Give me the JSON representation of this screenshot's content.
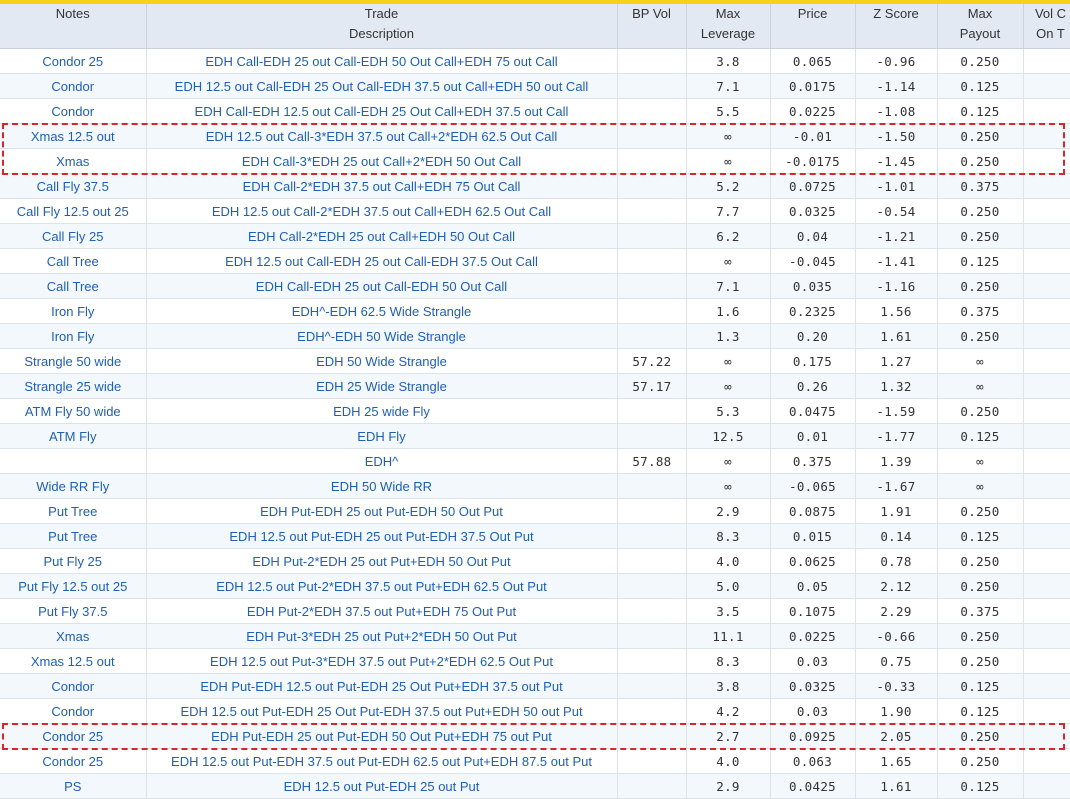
{
  "columns": [
    {
      "line1": "Notes",
      "line2": ""
    },
    {
      "line1": "Trade",
      "line2": "Description"
    },
    {
      "line1": "BP Vol",
      "line2": ""
    },
    {
      "line1": "Max",
      "line2": "Leverage"
    },
    {
      "line1": "Price",
      "line2": ""
    },
    {
      "line1": "Z Score",
      "line2": ""
    },
    {
      "line1": "Max",
      "line2": "Payout"
    },
    {
      "line1": "Vol C",
      "line2": "On T"
    }
  ],
  "rows": [
    {
      "notes": "Condor 25",
      "desc": "EDH Call-EDH 25 out Call-EDH 50 Out Call+EDH 75 out Call",
      "bp": "",
      "lev": "3.8",
      "price": "0.065",
      "z": "-0.96",
      "pay": "0.250",
      "vol": ""
    },
    {
      "notes": "Condor",
      "desc": "EDH 12.5 out Call-EDH 25 Out Call-EDH 37.5 out Call+EDH 50 out Call",
      "bp": "",
      "lev": "7.1",
      "price": "0.0175",
      "z": "-1.14",
      "pay": "0.125",
      "vol": ""
    },
    {
      "notes": "Condor",
      "desc": "EDH Call-EDH 12.5 out Call-EDH 25 Out Call+EDH 37.5 out Call",
      "bp": "",
      "lev": "5.5",
      "price": "0.0225",
      "z": "-1.08",
      "pay": "0.125",
      "vol": ""
    },
    {
      "notes": "Xmas 12.5 out",
      "desc": "EDH 12.5 out Call-3*EDH 37.5 out Call+2*EDH 62.5 Out Call",
      "bp": "",
      "lev": "∞",
      "price": "-0.01",
      "z": "-1.50",
      "pay": "0.250",
      "vol": ""
    },
    {
      "notes": "Xmas",
      "desc": "EDH Call-3*EDH 25 out Call+2*EDH 50 Out Call",
      "bp": "",
      "lev": "∞",
      "price": "-0.0175",
      "z": "-1.45",
      "pay": "0.250",
      "vol": ""
    },
    {
      "notes": "Call Fly 37.5",
      "desc": "EDH Call-2*EDH 37.5 out Call+EDH 75 Out Call",
      "bp": "",
      "lev": "5.2",
      "price": "0.0725",
      "z": "-1.01",
      "pay": "0.375",
      "vol": ""
    },
    {
      "notes": "Call Fly 12.5 out 25",
      "desc": "EDH 12.5 out Call-2*EDH 37.5 out Call+EDH 62.5 Out Call",
      "bp": "",
      "lev": "7.7",
      "price": "0.0325",
      "z": "-0.54",
      "pay": "0.250",
      "vol": ""
    },
    {
      "notes": "Call Fly 25",
      "desc": "EDH Call-2*EDH 25 out Call+EDH 50 Out Call",
      "bp": "",
      "lev": "6.2",
      "price": "0.04",
      "z": "-1.21",
      "pay": "0.250",
      "vol": ""
    },
    {
      "notes": "Call Tree",
      "desc": "EDH 12.5 out Call-EDH 25 out Call-EDH 37.5 Out Call",
      "bp": "",
      "lev": "∞",
      "price": "-0.045",
      "z": "-1.41",
      "pay": "0.125",
      "vol": ""
    },
    {
      "notes": "Call Tree",
      "desc": "EDH Call-EDH 25 out Call-EDH 50 Out Call",
      "bp": "",
      "lev": "7.1",
      "price": "0.035",
      "z": "-1.16",
      "pay": "0.250",
      "vol": ""
    },
    {
      "notes": "Iron Fly",
      "desc": "EDH^-EDH 62.5 Wide Strangle",
      "bp": "",
      "lev": "1.6",
      "price": "0.2325",
      "z": "1.56",
      "pay": "0.375",
      "vol": ""
    },
    {
      "notes": "Iron Fly",
      "desc": "EDH^-EDH 50 Wide Strangle",
      "bp": "",
      "lev": "1.3",
      "price": "0.20",
      "z": "1.61",
      "pay": "0.250",
      "vol": ""
    },
    {
      "notes": "Strangle 50 wide",
      "desc": "EDH 50 Wide Strangle",
      "bp": "57.22",
      "lev": "∞",
      "price": "0.175",
      "z": "1.27",
      "pay": "∞",
      "vol": "("
    },
    {
      "notes": "Strangle 25 wide",
      "desc": "EDH 25 Wide Strangle",
      "bp": "57.17",
      "lev": "∞",
      "price": "0.26",
      "z": "1.32",
      "pay": "∞",
      "vol": "("
    },
    {
      "notes": "ATM Fly 50 wide",
      "desc": "EDH 25 wide Fly",
      "bp": "",
      "lev": "5.3",
      "price": "0.0475",
      "z": "-1.59",
      "pay": "0.250",
      "vol": ""
    },
    {
      "notes": "ATM Fly",
      "desc": "EDH Fly",
      "bp": "",
      "lev": "12.5",
      "price": "0.01",
      "z": "-1.77",
      "pay": "0.125",
      "vol": ""
    },
    {
      "notes": "",
      "desc": "EDH^",
      "bp": "57.88",
      "lev": "∞",
      "price": "0.375",
      "z": "1.39",
      "pay": "∞",
      "vol": "("
    },
    {
      "notes": "Wide RR Fly",
      "desc": "EDH 50 Wide RR",
      "bp": "",
      "lev": "∞",
      "price": "-0.065",
      "z": "-1.67",
      "pay": "∞",
      "vol": ""
    },
    {
      "notes": "Put Tree",
      "desc": "EDH Put-EDH 25 out Put-EDH 50 Out Put",
      "bp": "",
      "lev": "2.9",
      "price": "0.0875",
      "z": "1.91",
      "pay": "0.250",
      "vol": ""
    },
    {
      "notes": "Put Tree",
      "desc": "EDH 12.5 out Put-EDH 25 out Put-EDH 37.5 Out Put",
      "bp": "",
      "lev": "8.3",
      "price": "0.015",
      "z": "0.14",
      "pay": "0.125",
      "vol": ""
    },
    {
      "notes": "Put Fly 25",
      "desc": "EDH Put-2*EDH 25 out Put+EDH 50 Out Put",
      "bp": "",
      "lev": "4.0",
      "price": "0.0625",
      "z": "0.78",
      "pay": "0.250",
      "vol": ""
    },
    {
      "notes": "Put Fly 12.5 out 25",
      "desc": "EDH 12.5 out Put-2*EDH 37.5 out Put+EDH 62.5 Out Put",
      "bp": "",
      "lev": "5.0",
      "price": "0.05",
      "z": "2.12",
      "pay": "0.250",
      "vol": ""
    },
    {
      "notes": "Put Fly 37.5",
      "desc": "EDH Put-2*EDH 37.5 out Put+EDH 75 Out Put",
      "bp": "",
      "lev": "3.5",
      "price": "0.1075",
      "z": "2.29",
      "pay": "0.375",
      "vol": ""
    },
    {
      "notes": "Xmas",
      "desc": "EDH Put-3*EDH 25 out Put+2*EDH 50 Out Put",
      "bp": "",
      "lev": "11.1",
      "price": "0.0225",
      "z": "-0.66",
      "pay": "0.250",
      "vol": ""
    },
    {
      "notes": "Xmas 12.5 out",
      "desc": "EDH 12.5 out Put-3*EDH 37.5 out Put+2*EDH 62.5 Out Put",
      "bp": "",
      "lev": "8.3",
      "price": "0.03",
      "z": "0.75",
      "pay": "0.250",
      "vol": ""
    },
    {
      "notes": "Condor",
      "desc": "EDH Put-EDH 12.5 out Put-EDH 25 Out Put+EDH 37.5 out Put",
      "bp": "",
      "lev": "3.8",
      "price": "0.0325",
      "z": "-0.33",
      "pay": "0.125",
      "vol": ""
    },
    {
      "notes": "Condor",
      "desc": "EDH 12.5 out Put-EDH 25 Out Put-EDH 37.5 out Put+EDH 50 out Put",
      "bp": "",
      "lev": "4.2",
      "price": "0.03",
      "z": "1.90",
      "pay": "0.125",
      "vol": ""
    },
    {
      "notes": "Condor 25",
      "desc": "EDH Put-EDH 25 out Put-EDH 50 Out Put+EDH 75 out Put",
      "bp": "",
      "lev": "2.7",
      "price": "0.0925",
      "z": "2.05",
      "pay": "0.250",
      "vol": ""
    },
    {
      "notes": "Condor 25",
      "desc": "EDH 12.5 out Put-EDH 37.5 out Put-EDH 62.5 out Put+EDH 87.5 out Put",
      "bp": "",
      "lev": "4.0",
      "price": "0.063",
      "z": "1.65",
      "pay": "0.250",
      "vol": ""
    },
    {
      "notes": "PS",
      "desc": "EDH 12.5 out Put-EDH 25 out Put",
      "bp": "",
      "lev": "2.9",
      "price": "0.0425",
      "z": "1.61",
      "pay": "0.125",
      "vol": ""
    }
  ],
  "highlights": [
    {
      "first_row": 3,
      "last_row": 4
    },
    {
      "first_row": 27,
      "last_row": 27
    }
  ],
  "colors": {
    "accent_bar": "#f7d216",
    "header_bg": "#e3e9f3",
    "link_text": "#1f5fb4",
    "highlight_border": "#d9262a"
  }
}
